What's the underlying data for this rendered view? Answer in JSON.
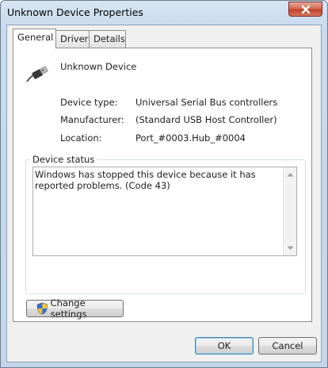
{
  "window": {
    "title": "Unknown Device Properties",
    "close_icon": "close-icon"
  },
  "tabs": [
    {
      "label": "General",
      "active": true
    },
    {
      "label": "Driver",
      "active": false
    },
    {
      "label": "Details",
      "active": false
    }
  ],
  "device": {
    "icon": "usb-plug-icon",
    "name": "Unknown Device",
    "properties": [
      {
        "label": "Device type:",
        "value": "Universal Serial Bus controllers"
      },
      {
        "label": "Manufacturer:",
        "value": "(Standard USB Host Controller)"
      },
      {
        "label": "Location:",
        "value": "Port_#0003.Hub_#0004"
      }
    ]
  },
  "status": {
    "legend": "Device status",
    "text": "Windows has stopped this device because it has reported problems. (Code 43)"
  },
  "change_settings": {
    "label": "Change settings",
    "icon": "uac-shield-icon"
  },
  "buttons": {
    "ok": "OK",
    "cancel": "Cancel"
  },
  "colors": {
    "title_bar": "#c9dbee",
    "close_button": "#c1422b",
    "default_button_border": "#3c7fb1"
  }
}
